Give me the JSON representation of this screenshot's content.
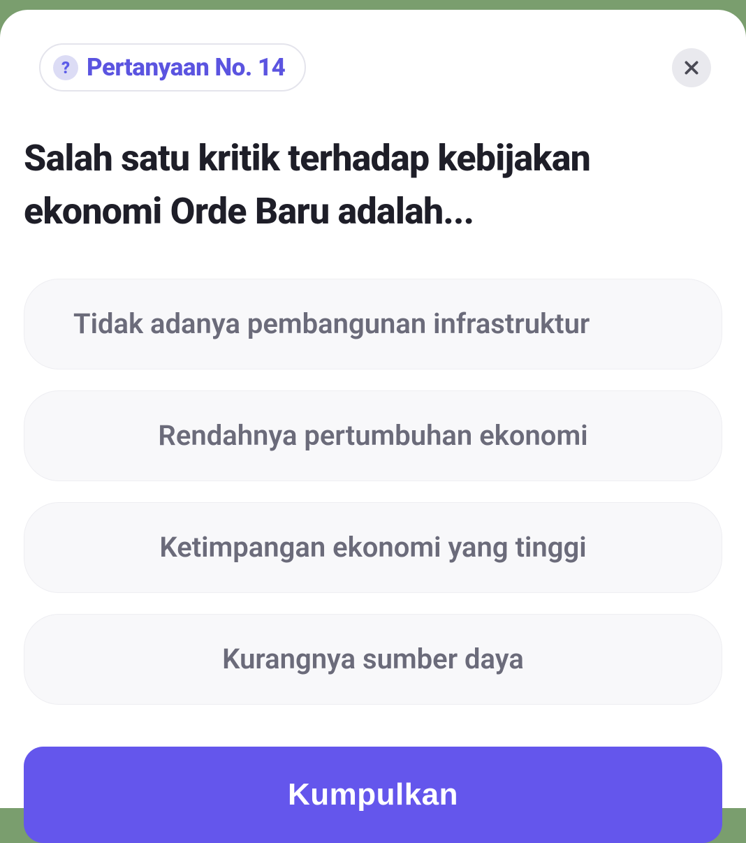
{
  "header": {
    "question_badge_label": "Pertanyaan No. 14",
    "question_badge_icon": "?"
  },
  "question": {
    "text": "Salah satu kritik terhadap kebijakan ekonomi Orde Baru adalah..."
  },
  "options": [
    {
      "label": "Tidak adanya pembangunan infrastruktur"
    },
    {
      "label": "Rendahnya pertumbuhan ekonomi"
    },
    {
      "label": "Ketimpangan ekonomi yang tinggi"
    },
    {
      "label": "Kurangnya sumber daya"
    }
  ],
  "submit": {
    "label": "Kumpulkan"
  }
}
